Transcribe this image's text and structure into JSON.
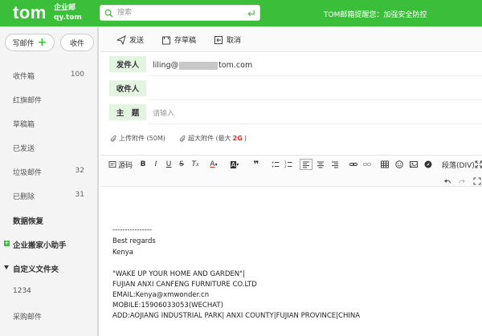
{
  "header": {
    "logo": "tom",
    "logo_sub_1": "企业邮",
    "logo_sub_2": "qy.tom",
    "search_placeholder": "搜索",
    "notice": "TOM邮箱提醒您：加强安全防控"
  },
  "sidebar": {
    "write_label": "写邮件",
    "receive_label": "收件",
    "folders": [
      {
        "label": "收件箱",
        "count": "100"
      },
      {
        "label": "红旗邮件",
        "count": ""
      },
      {
        "label": "草稿箱",
        "count": ""
      },
      {
        "label": "已发送",
        "count": ""
      },
      {
        "label": "垃圾邮件",
        "count": "32"
      },
      {
        "label": "已删除",
        "count": "31"
      }
    ],
    "data_recovery": "数据恢复",
    "mail_helper": "企业搬家小助手",
    "custom_folders": "自定义文件夹",
    "custom_items": [
      "1234",
      "采购邮件"
    ]
  },
  "toolbar": {
    "send": "发送",
    "save_draft": "存草稿",
    "cancel": "取消"
  },
  "compose": {
    "to_label": "发件人",
    "to_value_prefix": "liling@",
    "to_value_suffix": "tom.com",
    "receiver_label": "收件人",
    "subject_label": "主　题",
    "subject_placeholder": "请输入"
  },
  "attachments": {
    "upload": "上传附件 (50M)",
    "large_prefix": "超大附件 (最大 ",
    "large_size": "2G",
    "large_suffix": ")"
  },
  "editor_toolbar": {
    "source": "源码",
    "paragraph": "段落(DIV)"
  },
  "body": {
    "lines": [
      "----------------",
      "Best regards",
      "Kenya",
      "",
      " \"WAKE UP YOUR HOME AND GARDEN\"|",
      "FUJIAN ANXI CANFENG FURNITURE CO.LTD",
      "EMAIL:Kenya@xmwonder.cn",
      "MOBILE:15906033053(WECHAT)",
      "ADD:AOJIANG INDUSTRIAL PARK| ANXI COUNTY|FUJIAN PROVINCE|CHINA"
    ]
  },
  "colors": {
    "brand_green": "#3bbf3b",
    "label_bg": "#e3f4e1",
    "accent_red": "#d32f2f"
  }
}
